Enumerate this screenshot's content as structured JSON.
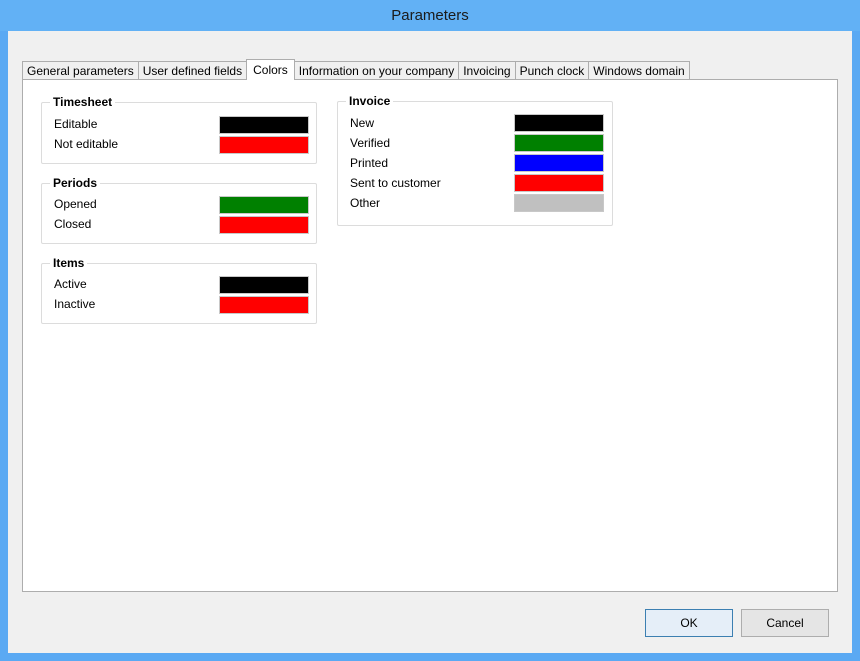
{
  "window": {
    "title": "Parameters"
  },
  "tabs": [
    {
      "label": "General parameters"
    },
    {
      "label": "User defined fields"
    },
    {
      "label": "Colors"
    },
    {
      "label": "Information on your company"
    },
    {
      "label": "Invoicing"
    },
    {
      "label": "Punch clock"
    },
    {
      "label": "Windows domain"
    }
  ],
  "active_tab": "Colors",
  "groups": {
    "timesheet": {
      "title": "Timesheet",
      "items": [
        {
          "label": "Editable",
          "color": "#000000"
        },
        {
          "label": "Not editable",
          "color": "#ff0000"
        }
      ]
    },
    "periods": {
      "title": "Periods",
      "items": [
        {
          "label": "Opened",
          "color": "#008000"
        },
        {
          "label": "Closed",
          "color": "#ff0000"
        }
      ]
    },
    "items": {
      "title": "Items",
      "items": [
        {
          "label": "Active",
          "color": "#000000"
        },
        {
          "label": "Inactive",
          "color": "#ff0000"
        }
      ]
    },
    "invoice": {
      "title": "Invoice",
      "items": [
        {
          "label": "New",
          "color": "#000000"
        },
        {
          "label": "Verified",
          "color": "#008000"
        },
        {
          "label": "Printed",
          "color": "#0000ff"
        },
        {
          "label": "Sent to customer",
          "color": "#ff0000"
        },
        {
          "label": "Other",
          "color": "#c0c0c0"
        }
      ]
    }
  },
  "buttons": {
    "ok": "OK",
    "cancel": "Cancel"
  }
}
